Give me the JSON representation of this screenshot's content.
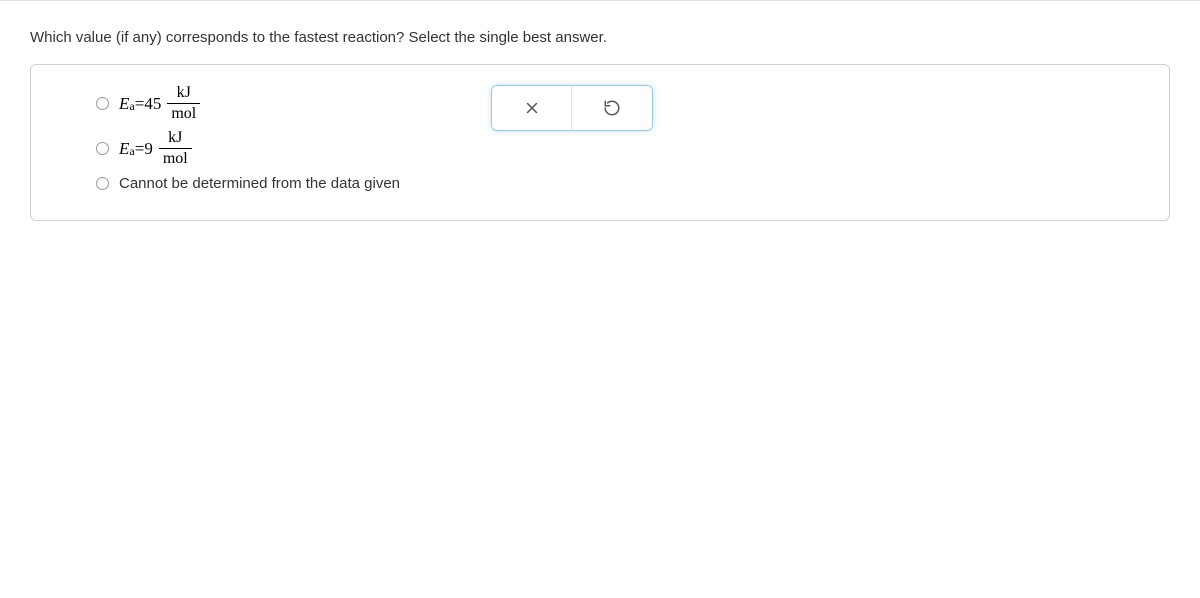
{
  "question": {
    "text": "Which value (if any) corresponds to the fastest reaction? Select the single best answer."
  },
  "options": {
    "opt1": {
      "symbol": "E",
      "subscript": "a",
      "equals": " = ",
      "value": "45",
      "frac_num": "kJ",
      "frac_den": "mol"
    },
    "opt2": {
      "symbol": "E",
      "subscript": "a",
      "equals": " = ",
      "value": "9",
      "frac_num": "kJ",
      "frac_den": "mol"
    },
    "opt3": {
      "text": "Cannot be determined from the data given"
    }
  },
  "actions": {
    "close_label": "close",
    "reset_label": "reset"
  }
}
